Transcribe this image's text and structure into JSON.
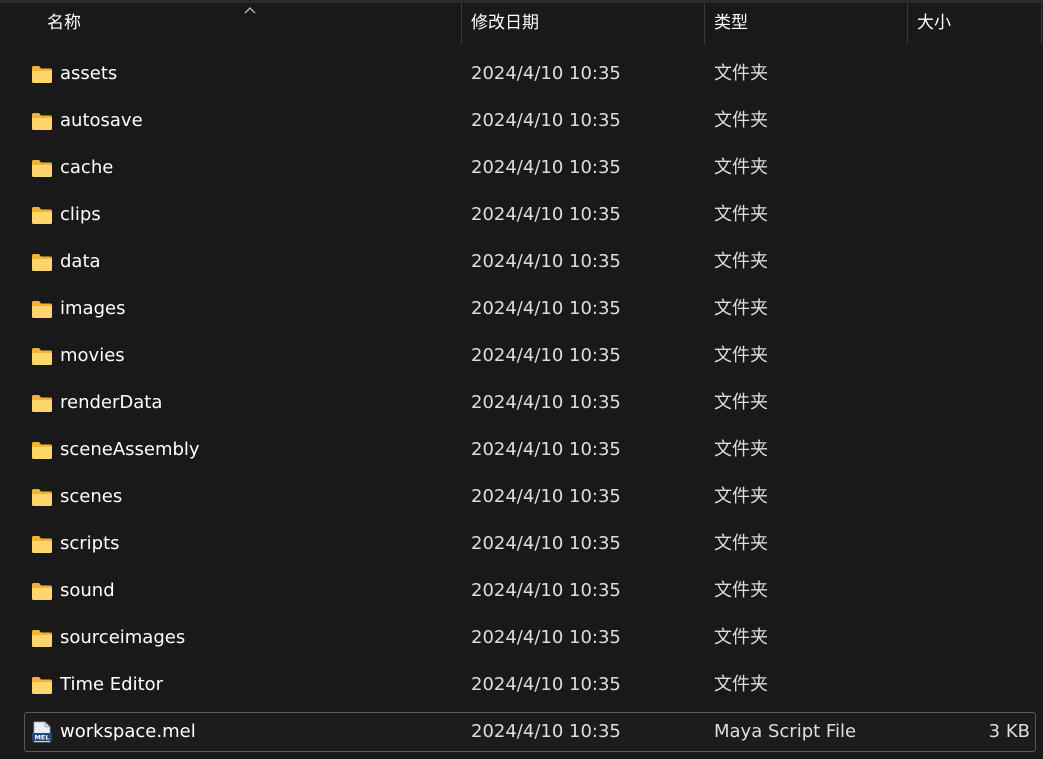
{
  "columns": {
    "name": "名称",
    "date": "修改日期",
    "type": "类型",
    "size": "大小"
  },
  "rows": [
    {
      "name": "assets",
      "date": "2024/4/10 10:35",
      "type": "文件夹",
      "size": "",
      "icon": "folder-icon"
    },
    {
      "name": "autosave",
      "date": "2024/4/10 10:35",
      "type": "文件夹",
      "size": "",
      "icon": "folder-icon"
    },
    {
      "name": "cache",
      "date": "2024/4/10 10:35",
      "type": "文件夹",
      "size": "",
      "icon": "folder-icon"
    },
    {
      "name": "clips",
      "date": "2024/4/10 10:35",
      "type": "文件夹",
      "size": "",
      "icon": "folder-icon"
    },
    {
      "name": "data",
      "date": "2024/4/10 10:35",
      "type": "文件夹",
      "size": "",
      "icon": "folder-icon"
    },
    {
      "name": "images",
      "date": "2024/4/10 10:35",
      "type": "文件夹",
      "size": "",
      "icon": "folder-icon"
    },
    {
      "name": "movies",
      "date": "2024/4/10 10:35",
      "type": "文件夹",
      "size": "",
      "icon": "folder-icon"
    },
    {
      "name": "renderData",
      "date": "2024/4/10 10:35",
      "type": "文件夹",
      "size": "",
      "icon": "folder-icon"
    },
    {
      "name": "sceneAssembly",
      "date": "2024/4/10 10:35",
      "type": "文件夹",
      "size": "",
      "icon": "folder-icon"
    },
    {
      "name": "scenes",
      "date": "2024/4/10 10:35",
      "type": "文件夹",
      "size": "",
      "icon": "folder-icon"
    },
    {
      "name": "scripts",
      "date": "2024/4/10 10:35",
      "type": "文件夹",
      "size": "",
      "icon": "folder-icon"
    },
    {
      "name": "sound",
      "date": "2024/4/10 10:35",
      "type": "文件夹",
      "size": "",
      "icon": "folder-icon"
    },
    {
      "name": "sourceimages",
      "date": "2024/4/10 10:35",
      "type": "文件夹",
      "size": "",
      "icon": "folder-icon"
    },
    {
      "name": "Time Editor",
      "date": "2024/4/10 10:35",
      "type": "文件夹",
      "size": "",
      "icon": "folder-icon"
    },
    {
      "name": "workspace.mel",
      "date": "2024/4/10 10:35",
      "type": "Maya Script File",
      "size": "3 KB",
      "icon": "mel-file-icon",
      "icon_label": "MEL",
      "selected": true
    }
  ],
  "colors": {
    "background": "#191919",
    "folder_light": "#FFD66B",
    "folder_dark": "#F2B233",
    "selection_border": "#5a5a5a"
  }
}
